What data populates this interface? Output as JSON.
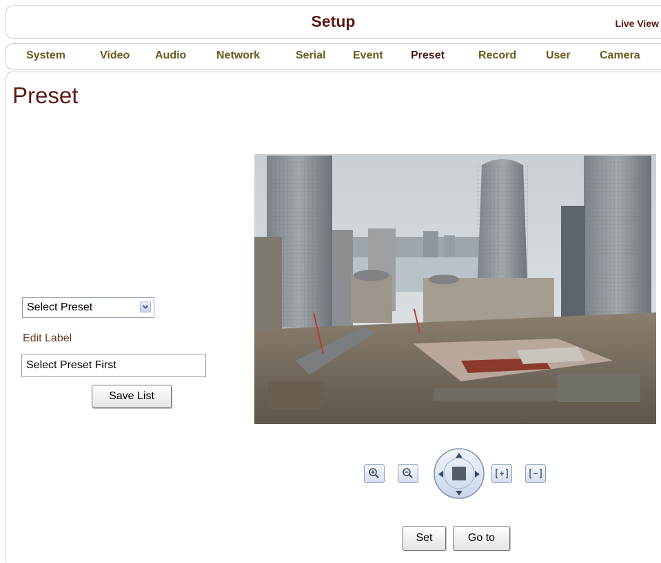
{
  "header": {
    "title": "Setup",
    "live_view": "Live View"
  },
  "nav": {
    "active": "Preset",
    "items": [
      {
        "label": "System"
      },
      {
        "label": "Video"
      },
      {
        "label": "Audio"
      },
      {
        "label": "Network"
      },
      {
        "label": "Serial"
      },
      {
        "label": "Event"
      },
      {
        "label": "Preset"
      },
      {
        "label": "Record"
      },
      {
        "label": "User"
      },
      {
        "label": "Camera"
      }
    ]
  },
  "page": {
    "title": "Preset"
  },
  "preset_panel": {
    "select_value": "Select Preset",
    "edit_label": "Edit Label",
    "label_input_value": "Select Preset First",
    "save_button": "Save List"
  },
  "ptz_controls": {
    "zoom_in": "zoom-in-icon",
    "zoom_out": "zoom-out-icon",
    "focus_near": "focus-near-icon",
    "focus_far": "focus-far-icon",
    "set_button": "Set",
    "goto_button": "Go to"
  },
  "colors": {
    "title": "#5c1a12",
    "nav_text": "#6b5a1e",
    "border": "#c8c8c8"
  }
}
